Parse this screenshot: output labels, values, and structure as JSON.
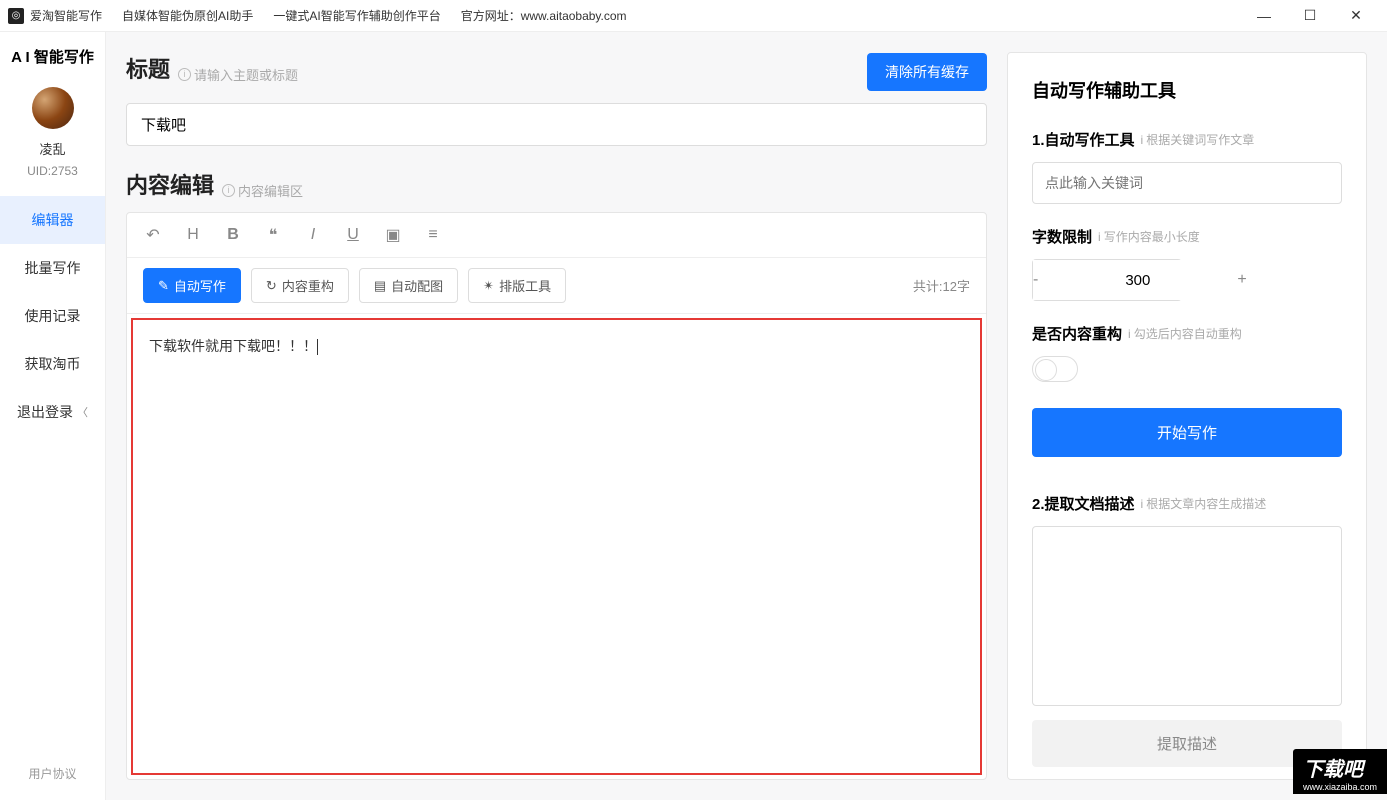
{
  "titlebar": {
    "app_name": "爱淘智能写作",
    "tagline1": "自媒体智能伪原创AI助手",
    "tagline2": "一键式AI智能写作辅助创作平台",
    "website_label": "官方网址：",
    "website_url": "www.aitaobaby.com"
  },
  "sidebar": {
    "brand": "A I 智能写作",
    "username": "凌乱",
    "uid": "UID:2753",
    "nav": {
      "editor": "编辑器",
      "batch": "批量写作",
      "history": "使用记录",
      "coins": "获取淘币",
      "logout": "退出登录"
    },
    "footer": "用户协议"
  },
  "editor": {
    "title_label": "标题",
    "title_hint": "请输入主题或标题",
    "title_value": "下载吧",
    "clear_cache": "清除所有缓存",
    "content_label": "内容编辑",
    "content_hint": "内容编辑区",
    "toolbar": {
      "auto_write": "自动写作",
      "restructure": "内容重构",
      "auto_image": "自动配图",
      "layout_tool": "排版工具"
    },
    "word_count": "共计:12字",
    "content_text": "下载软件就用下载吧！！！"
  },
  "sidepanel": {
    "title": "自动写作辅助工具",
    "tool1_label": "1.自动写作工具",
    "tool1_hint": "根据关键词写作文章",
    "keyword_placeholder": "点此输入关键词",
    "wordlimit_label": "字数限制",
    "wordlimit_hint": "写作内容最小长度",
    "wordlimit_value": "300",
    "restructure_label": "是否内容重构",
    "restructure_hint": "勾选后内容自动重构",
    "start_button": "开始写作",
    "tool2_label": "2.提取文档描述",
    "tool2_hint": "根据文章内容生成描述",
    "extract_button": "提取描述"
  },
  "watermark": {
    "text": "下载吧",
    "url": "www.xiazaiba.com"
  }
}
